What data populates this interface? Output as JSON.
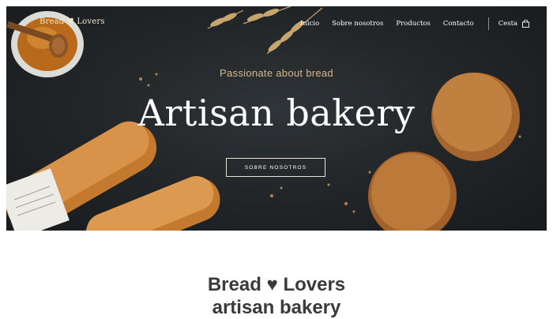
{
  "header": {
    "brand": "Bread ♥ Lovers",
    "nav": [
      {
        "label": "Inicio"
      },
      {
        "label": "Sobre nosotros"
      },
      {
        "label": "Productos"
      },
      {
        "label": "Contacto"
      }
    ],
    "cart_label": "Cesta",
    "cart_icon": "shopping-bag-icon"
  },
  "hero": {
    "tagline": "Passionate about bread",
    "headline": "Artisan bakery",
    "cta_label": "SOBRE NOSOTROS"
  },
  "about": {
    "title_line1": "Bread ♥ Lovers",
    "title_line2": "artisan bakery"
  },
  "colors": {
    "hero_bg": "#23272a",
    "accent": "#d9b58a",
    "text_dark": "#3a3a3a"
  }
}
